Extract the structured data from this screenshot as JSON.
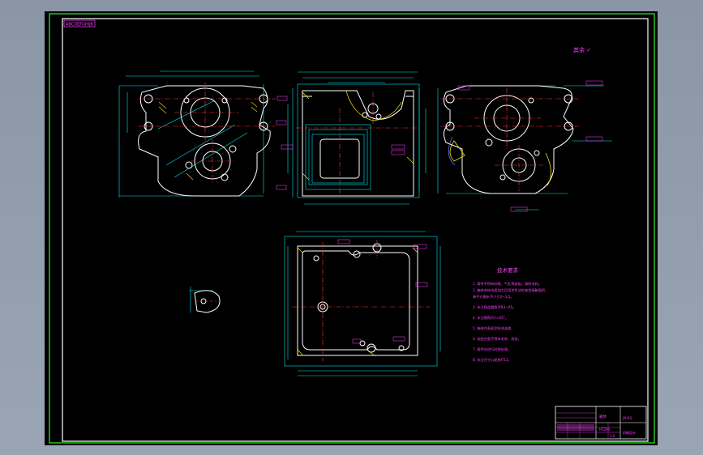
{
  "drawing": {
    "stamp_top_left": "ABCDEFGHIJK",
    "note_top_right": "其余 ✓",
    "tech_requirements_title": "技术要求",
    "tech_requirements": [
      "1. 铸件不得有砂眼、气孔等缺陷，清除毛刺。",
      "2. 箱体各结合面加工后用涂色法检查其接触面积，",
      "   每平方厘米不少于2~3点。",
      "3. 未注铸造圆角为R3~R5。",
      "4. 未注倒角为1×45°。",
      "5. 箱体内表面涂耐油油漆。",
      "6. 各配合面不得有毛刺、划伤。",
      "7. 铸件应进行时效处理。",
      "8. 未注尺寸公差按IT12。"
    ],
    "title_block": {
      "part_name": "箱体",
      "drawing_no": "JX-01",
      "material": "HT200",
      "scale": "1:2",
      "company": "机械设计"
    }
  },
  "colors": {
    "frame_outer": "#27c32a",
    "frame_inner": "#ffffff",
    "outline": "#ffffff",
    "dimension": "#00e5ee",
    "centerline": "#ff3b3b",
    "hatch": "#ffe000",
    "annotation": "#ff40ff",
    "hidden": "#4a7dff"
  }
}
